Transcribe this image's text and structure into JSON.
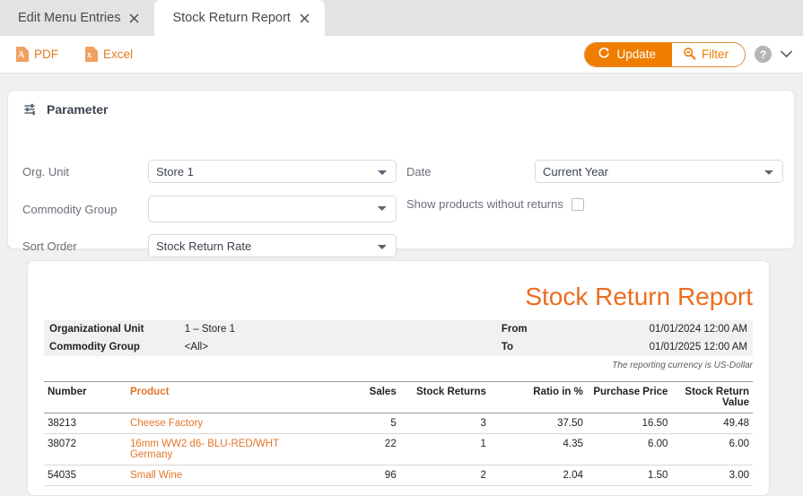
{
  "tabs": [
    {
      "label": "Edit Menu Entries",
      "active": false,
      "close_icon": "close-icon"
    },
    {
      "label": "Stock Return Report",
      "active": true,
      "close_icon": "close-icon"
    }
  ],
  "toolbar": {
    "pdf_label": "PDF",
    "pdf_glyph": "A",
    "excel_label": "Excel",
    "excel_glyph": "x",
    "update_label": "Update",
    "filter_label": "Filter",
    "help_glyph": "?",
    "chevron_glyph": "⌄",
    "accent_color": "#ef7d00",
    "link_color": "#e07b1e"
  },
  "parameter": {
    "title": "Parameter",
    "org_unit_label": "Org. Unit",
    "org_unit_value": "Store 1",
    "commodity_group_label": "Commodity Group",
    "commodity_group_value": "",
    "sort_order_label": "Sort Order",
    "sort_order_value": "Stock Return Rate",
    "date_label": "Date",
    "date_value": "Current Year",
    "show_products_label": "Show products without returns",
    "show_products_checked": false
  },
  "report": {
    "title": "Stock Return Report",
    "title_color": "#ec6d20",
    "info": [
      {
        "key": "Organizational Unit",
        "value": "1 – Store 1",
        "key2": "From",
        "value2": "01/01/2024 12:00 AM"
      },
      {
        "key": "Commodity Group",
        "value": "<All>",
        "key2": "To",
        "value2": "01/01/2025 12:00 AM"
      }
    ],
    "currency_note": "The reporting currency is US-Dollar",
    "columns": {
      "number": "Number",
      "product": "Product",
      "sales": "Sales",
      "stock_returns": "Stock Returns",
      "ratio": "Ratio in %",
      "purchase_price": "Purchase Price",
      "stock_return_value": "Stock Return Value"
    },
    "rows": [
      {
        "number": "38213",
        "product": "Cheese Factory",
        "sales": "5",
        "stock_returns": "3",
        "ratio": "37.50",
        "purchase_price": "16.50",
        "stock_return_value": "49.48"
      },
      {
        "number": "38072",
        "product": "16mm WW2 d6- BLU-RED/WHT Germany",
        "sales": "22",
        "stock_returns": "1",
        "ratio": "4.35",
        "purchase_price": "6.00",
        "stock_return_value": "6.00"
      },
      {
        "number": "54035",
        "product": "Small Wine",
        "sales": "96",
        "stock_returns": "2",
        "ratio": "2.04",
        "purchase_price": "1.50",
        "stock_return_value": "3.00"
      }
    ]
  }
}
